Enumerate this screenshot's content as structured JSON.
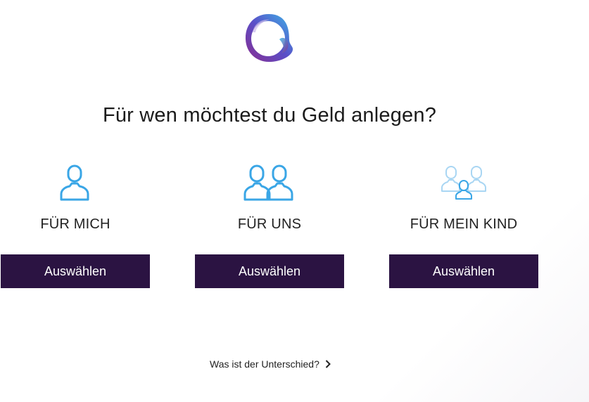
{
  "brand": {
    "logo_icon": "circle-logo-icon",
    "gradient_colors": [
      "#8a2d8f",
      "#5a4fc8",
      "#3cb6e8"
    ]
  },
  "headline": "Für wen möchtest du Geld anlegen?",
  "options": [
    {
      "icon": "single-person-icon",
      "label": "FÜR MICH",
      "button_label": "Auswählen"
    },
    {
      "icon": "two-persons-icon",
      "label": "FÜR UNS",
      "button_label": "Auswählen"
    },
    {
      "icon": "family-icon",
      "label": "FÜR MEIN KIND",
      "button_label": "Auswählen"
    }
  ],
  "footer_link": {
    "label": "Was ist der Unterschied?",
    "icon": "chevron-right-icon"
  },
  "colors": {
    "button_bg": "#2b1342",
    "icon_blue": "#3aa6e6",
    "icon_light_blue": "#a9d6f3"
  }
}
